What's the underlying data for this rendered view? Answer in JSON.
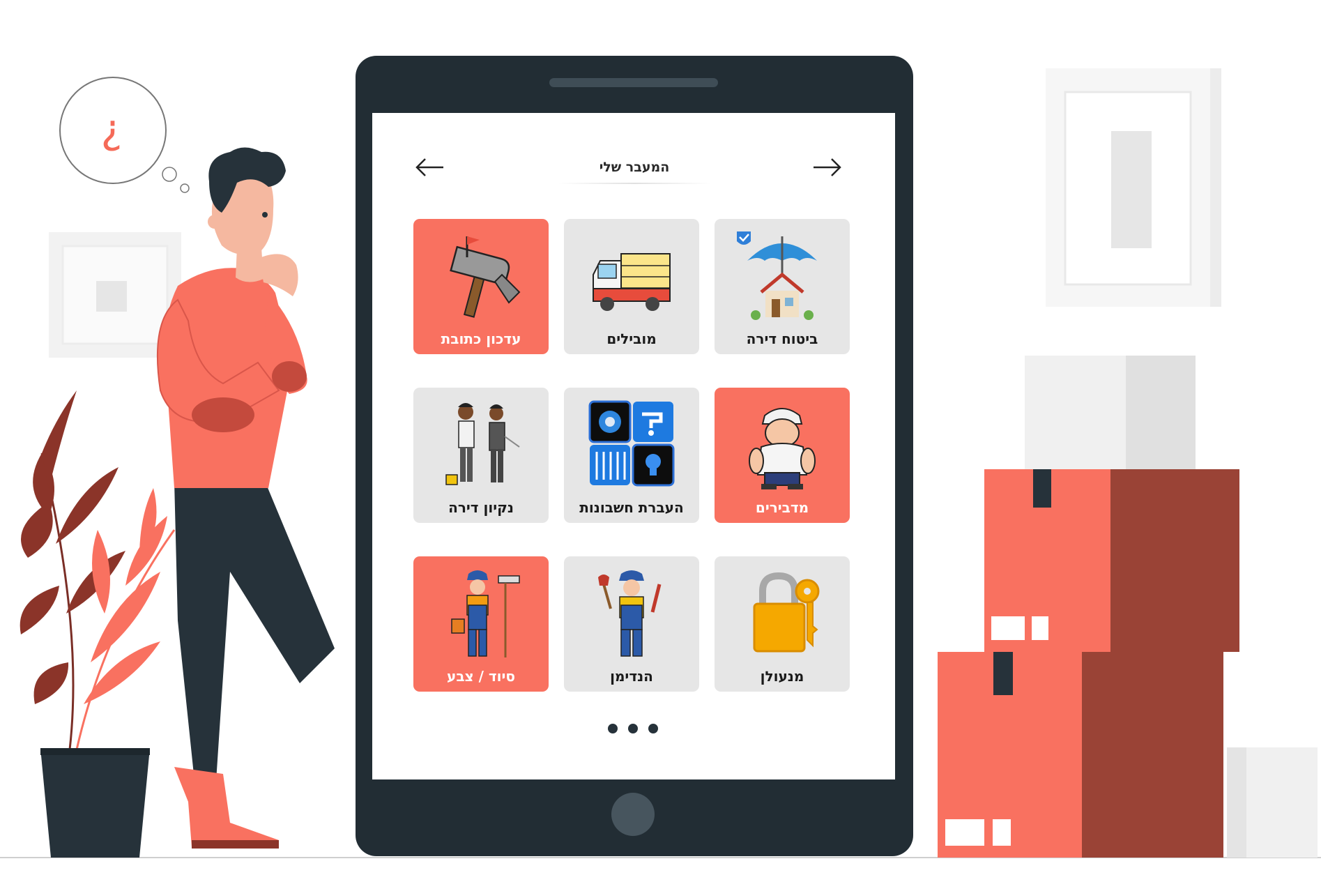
{
  "header": {
    "title": "המעבר שלי",
    "back_icon": "arrow-left-icon",
    "forward_icon": "arrow-right-icon"
  },
  "thought_bubble": {
    "symbol": "¿"
  },
  "tiles": [
    {
      "label": "ביטוח דירה",
      "icon": "house-insurance-icon",
      "color": "#e6e6e6"
    },
    {
      "label": "מובילים",
      "icon": "moving-truck-icon",
      "color": "#e6e6e6"
    },
    {
      "label": "עדכון כתובת",
      "icon": "mailbox-icon",
      "color": "#f97160"
    },
    {
      "label": "מדבירים",
      "icon": "exterminator-icon",
      "color": "#f97160"
    },
    {
      "label": "העברת חשבונות",
      "icon": "utilities-icon",
      "color": "#e6e6e6"
    },
    {
      "label": "נקיון דירה",
      "icon": "cleaners-icon",
      "color": "#e6e6e6"
    },
    {
      "label": "מנעולן",
      "icon": "padlock-key-icon",
      "color": "#e6e6e6"
    },
    {
      "label": "הנדימן",
      "icon": "plumber-icon",
      "color": "#e6e6e6"
    },
    {
      "label": "סיוד / צבע",
      "icon": "painter-icon",
      "color": "#f97160"
    }
  ],
  "pagination": {
    "dots": 3
  },
  "colors": {
    "accent": "#f97160",
    "tablet": "#222d34",
    "tile_gray": "#e6e6e6",
    "box_dark": "#9a4336"
  }
}
